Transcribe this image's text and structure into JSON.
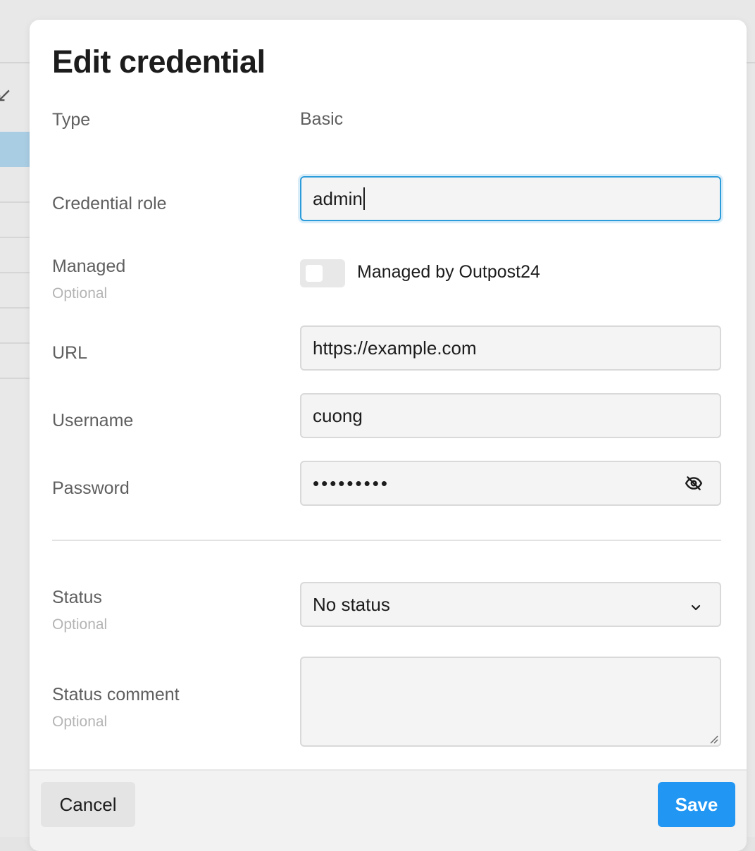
{
  "modal": {
    "title": "Edit credential",
    "fields": {
      "type": {
        "label": "Type",
        "value": "Basic"
      },
      "credential_role": {
        "label": "Credential role",
        "value": "admin"
      },
      "managed": {
        "label": "Managed",
        "optional": "Optional",
        "toggle_label": "Managed by Outpost24",
        "checked": false
      },
      "url": {
        "label": "URL",
        "value": "https://example.com"
      },
      "username": {
        "label": "Username",
        "value": "cuong"
      },
      "password": {
        "label": "Password",
        "masked": "•••••••••"
      },
      "status": {
        "label": "Status",
        "optional": "Optional",
        "selected": "No status"
      },
      "status_comment": {
        "label": "Status comment",
        "optional": "Optional",
        "value": ""
      }
    },
    "footer": {
      "cancel_label": "Cancel",
      "save_label": "Save"
    }
  },
  "colors": {
    "accent": "#2196f3",
    "focus_border": "#2d9cdb"
  },
  "icons": {
    "password_toggle": "eye-slash-icon",
    "status_dropdown": "chevron-down-icon"
  }
}
